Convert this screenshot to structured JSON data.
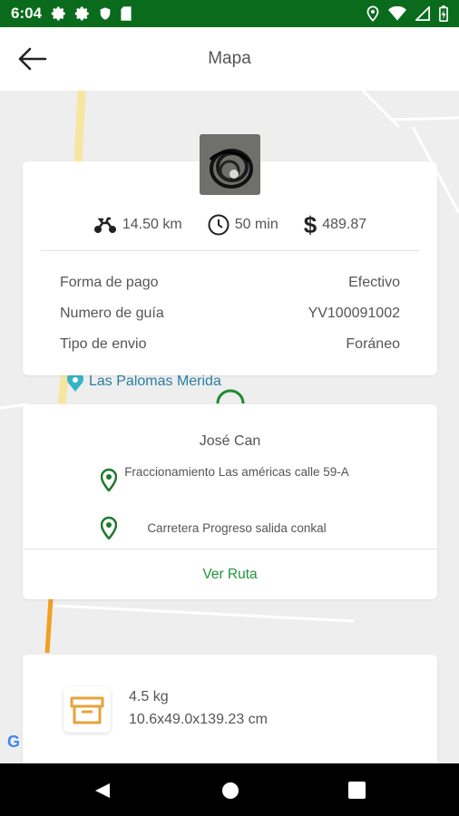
{
  "status_bar": {
    "time": "6:04"
  },
  "app_bar": {
    "title": "Mapa"
  },
  "map": {
    "poi_label": "Las Palomas Merida",
    "google_mark": "G"
  },
  "order": {
    "distance": "14.50 km",
    "duration": "50 min",
    "currency_symbol": "$",
    "price": "489.87",
    "details": [
      {
        "label": "Forma de pago",
        "value": "Efectivo"
      },
      {
        "label": "Numero de guía",
        "value": "YV100091002"
      },
      {
        "label": "Tipo de envio",
        "value": "Foráneo"
      }
    ]
  },
  "route": {
    "recipient": "José Can",
    "origin": "Fraccionamiento Las américas calle 59-A",
    "destination": "Carretera Progreso salida conkal",
    "view_route_label": "Ver Ruta"
  },
  "package": {
    "weight": "4.5 kg",
    "dimensions": "10.6x49.0x139.23 cm"
  },
  "colors": {
    "status_bar": "#0a6b1c",
    "accent_green": "#1f9437",
    "box_icon": "#e8a23a"
  }
}
